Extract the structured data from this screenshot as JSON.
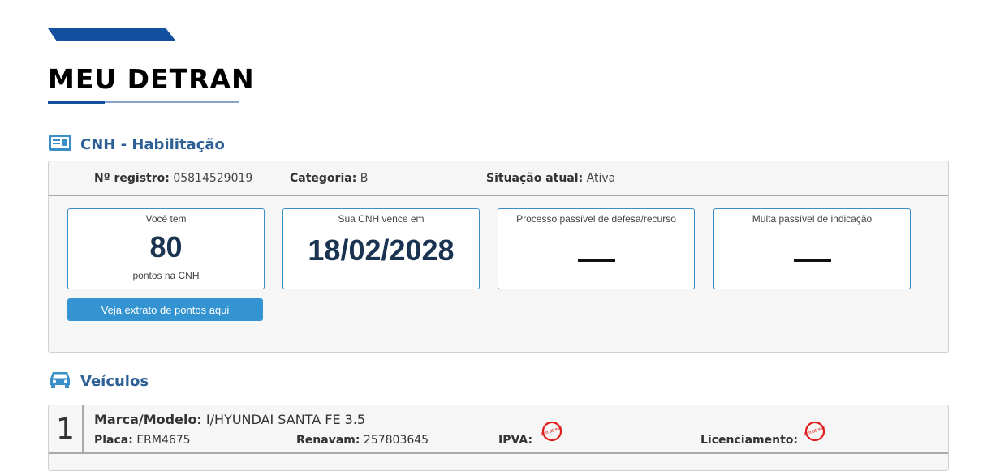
{
  "page": {
    "title": "MEU DETRAN"
  },
  "cnh": {
    "heading": "CNH - Habilitação",
    "registro_label": "Nº registro:",
    "registro_value": "05814529019",
    "categoria_label": "Categoria:",
    "categoria_value": "B",
    "situacao_label": "Situação atual:",
    "situacao_value": "Ativa",
    "cards": [
      {
        "caption": "Você tem",
        "value": "80",
        "sub": "pontos na CNH"
      },
      {
        "caption": "Sua CNH vence em",
        "value": "18/02/2028"
      },
      {
        "caption": "Processo passível de defesa/recurso",
        "value": "—"
      },
      {
        "caption": "Multa passível de indicação",
        "value": "—"
      }
    ],
    "extrato_button": "Veja extrato de pontos aqui"
  },
  "veiculos": {
    "heading": "Veículos",
    "items": [
      {
        "index": "1",
        "modelo_label": "Marca/Modelo:",
        "modelo_value": "I/HYUNDAI SANTA FE 3.5",
        "placa_label": "Placa:",
        "placa_value": "ERM4675",
        "renavam_label": "Renavam:",
        "renavam_value": "257803645",
        "ipva_label": "IPVA:",
        "ipva_stamp": "Em atraso",
        "licenciamento_label": "Licenciamento:",
        "licenciamento_stamp": "Em atraso"
      }
    ]
  },
  "colors": {
    "brand_blue": "#1351a0",
    "heading_blue": "#2e6096",
    "button_blue": "#3494d1",
    "stamp_red": "#e01b1b"
  },
  "icons": {
    "cnh": "id-card-icon",
    "veiculos": "car-icon"
  }
}
